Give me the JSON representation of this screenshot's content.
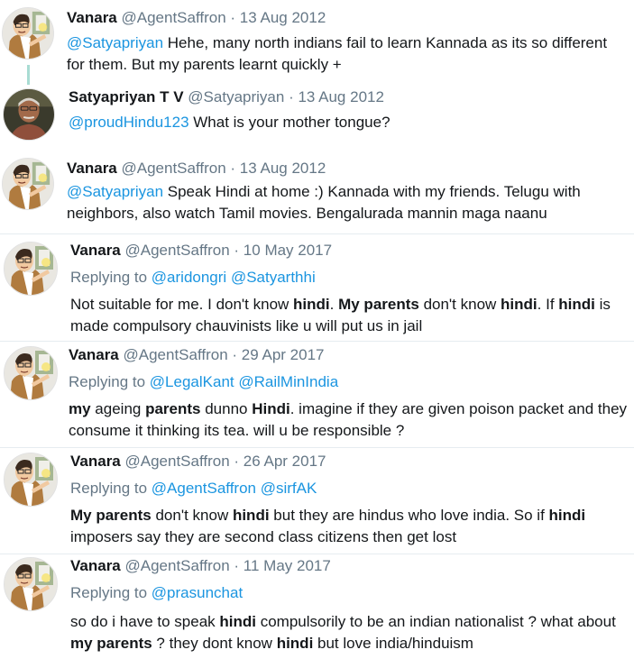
{
  "tweets": [
    {
      "name": "Vanara",
      "handle": "@AgentSaffron",
      "date": "· 13 Aug 2012",
      "reply_to": [],
      "avatar": "cartoon-man-avatar",
      "segments": [
        {
          "t": "@Satyapriyan",
          "s": "mention"
        },
        {
          "t": " Hehe, many north indians fail to learn Kannada as its so different for them. But my parents learnt quickly +",
          "s": "plain"
        }
      ]
    },
    {
      "name": "Satyapriyan T V",
      "handle": "@Satyapriyan",
      "date": "· 13 Aug 2012",
      "reply_to": [],
      "avatar": "photo-man-avatar",
      "segments": [
        {
          "t": "@proudHindu123",
          "s": "mention"
        },
        {
          "t": " What is your mother tongue?",
          "s": "plain"
        }
      ]
    },
    {
      "name": "Vanara",
      "handle": "@AgentSaffron",
      "date": "· 13 Aug 2012",
      "reply_to": [],
      "avatar": "cartoon-man-avatar",
      "segments": [
        {
          "t": "@Satyapriyan",
          "s": "mention"
        },
        {
          "t": " Speak Hindi at home :) Kannada with my friends. Telugu with neighbors, also watch Tamil movies. Bengalurada mannin maga naanu",
          "s": "plain"
        }
      ]
    },
    {
      "name": "Vanara",
      "handle": "@AgentSaffron",
      "date": "· 10 May 2017",
      "reply_prefix": "Replying to",
      "reply_to": [
        "@aridongri",
        "@Satyarthhi"
      ],
      "avatar": "cartoon-man-avatar",
      "segments": [
        {
          "t": "Not suitable for me. I don't know ",
          "s": "plain"
        },
        {
          "t": "hindi",
          "s": "bold"
        },
        {
          "t": ". ",
          "s": "plain"
        },
        {
          "t": "My parents",
          "s": "bold"
        },
        {
          "t": " don't know ",
          "s": "plain"
        },
        {
          "t": "hindi",
          "s": "bold"
        },
        {
          "t": ". If ",
          "s": "plain"
        },
        {
          "t": "hindi",
          "s": "bold"
        },
        {
          "t": " is made compulsory chauvinists like u will put us in jail",
          "s": "plain"
        }
      ]
    },
    {
      "name": "Vanara",
      "handle": "@AgentSaffron",
      "date": "· 29 Apr 2017",
      "reply_prefix": "Replying to",
      "reply_to": [
        "@LegalKant",
        "@RailMinIndia"
      ],
      "avatar": "cartoon-man-avatar",
      "segments": [
        {
          "t": "my",
          "s": "bold"
        },
        {
          "t": " ageing ",
          "s": "plain"
        },
        {
          "t": "parents",
          "s": "bold"
        },
        {
          "t": " dunno ",
          "s": "plain"
        },
        {
          "t": "Hindi",
          "s": "bold"
        },
        {
          "t": ". imagine if they are given poison packet and they consume it thinking its tea. will u be responsible ?",
          "s": "plain"
        }
      ]
    },
    {
      "name": "Vanara",
      "handle": "@AgentSaffron",
      "date": "· 26 Apr 2017",
      "reply_prefix": "Replying to",
      "reply_to": [
        "@AgentSaffron",
        "@sirfAK"
      ],
      "avatar": "cartoon-man-avatar",
      "segments": [
        {
          "t": "My parents",
          "s": "bold"
        },
        {
          "t": " don't know ",
          "s": "plain"
        },
        {
          "t": "hindi",
          "s": "bold"
        },
        {
          "t": " but they are hindus who love india. So if ",
          "s": "plain"
        },
        {
          "t": "hindi",
          "s": "bold"
        },
        {
          "t": " imposers say they are second class citizens then get lost",
          "s": "plain"
        }
      ]
    },
    {
      "name": "Vanara",
      "handle": "@AgentSaffron",
      "date": "· 11 May 2017",
      "reply_prefix": "Replying to",
      "reply_to": [
        "@prasunchat"
      ],
      "avatar": "cartoon-man-avatar",
      "segments": [
        {
          "t": "so do i have to speak ",
          "s": "plain"
        },
        {
          "t": "hindi",
          "s": "bold"
        },
        {
          "t": " compulsorily to be an indian nationalist ? what about ",
          "s": "plain"
        },
        {
          "t": "my parents",
          "s": "bold"
        },
        {
          "t": " ? they dont know ",
          "s": "plain"
        },
        {
          "t": "hindi",
          "s": "bold"
        },
        {
          "t": " but love india/hinduism",
          "s": "plain"
        }
      ]
    }
  ],
  "colors": {
    "mention": "#1b95e0",
    "secondary": "#657786",
    "thread_line": "#a9dcd3"
  }
}
